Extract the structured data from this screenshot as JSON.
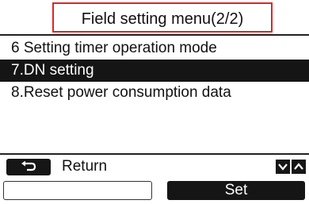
{
  "header": {
    "title": "Field setting menu(2/2)"
  },
  "menu": {
    "items": [
      {
        "label": "6 Setting timer operation mode",
        "selected": false
      },
      {
        "label": "7.DN setting",
        "selected": true
      },
      {
        "label": "8.Reset power consumption data",
        "selected": false
      }
    ]
  },
  "footer": {
    "return_label": "Return",
    "left_button_label": "",
    "set_button_label": "Set"
  },
  "colors": {
    "highlight_border": "#e02424",
    "selection_bg": "#151515"
  },
  "icons": {
    "return": "return-arrow-icon",
    "down": "chevron-down-icon",
    "up": "chevron-up-icon"
  }
}
